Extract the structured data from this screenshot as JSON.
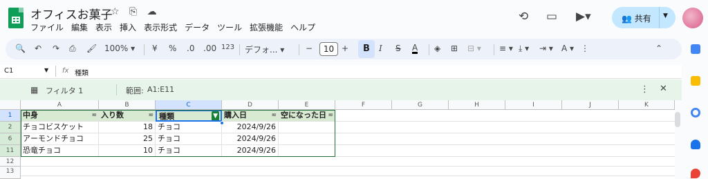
{
  "doc": {
    "title": "オフィスお菓子"
  },
  "menu": [
    "ファイル",
    "編集",
    "表示",
    "挿入",
    "表示形式",
    "データ",
    "ツール",
    "拡張機能",
    "ヘルプ"
  ],
  "toolbar": {
    "zoom": "100%",
    "currency": "¥",
    "percent": "%",
    "dec_less": ".0",
    "dec_more": ".00",
    "number_format": "123",
    "font": "デフォ...",
    "font_size": "10",
    "bold": "B",
    "italic": "I",
    "strike": "S",
    "text_color": "A"
  },
  "share": {
    "label": "共有"
  },
  "formula": {
    "cell_ref": "C1",
    "fx": "fx",
    "content": "種類"
  },
  "filter": {
    "name": "フィルタ 1",
    "range_label": "範囲:",
    "range": "A1:E11"
  },
  "columns": [
    "A",
    "B",
    "C",
    "D",
    "E",
    "F",
    "G",
    "H",
    "I",
    "J",
    "K"
  ],
  "headers": [
    "中身",
    "入り数",
    "種類",
    "購入日",
    "空になった日"
  ],
  "rows": [
    {
      "num": "2",
      "cells": [
        "チョコビスケット",
        "18",
        "チョコ",
        "2024/9/26",
        ""
      ]
    },
    {
      "num": "6",
      "cells": [
        "アーモンドチョコ",
        "25",
        "チョコ",
        "2024/9/26",
        ""
      ]
    },
    {
      "num": "11",
      "cells": [
        "恐竜チョコ",
        "10",
        "チョコ",
        "2024/9/26",
        ""
      ]
    }
  ],
  "row_nums": {
    "header": "1",
    "empty1": "12",
    "empty2": "13"
  }
}
